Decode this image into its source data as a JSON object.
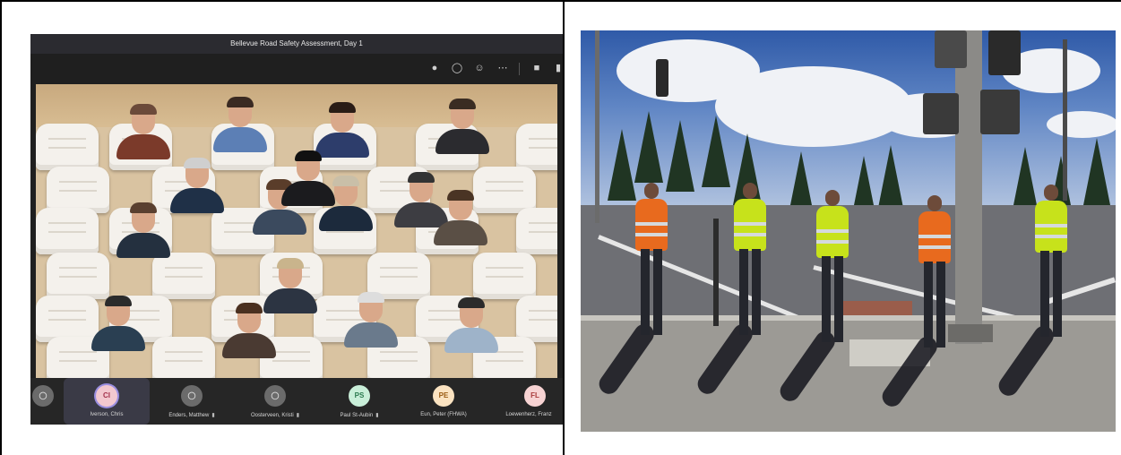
{
  "meeting": {
    "title": "Bellevue Road Safety Assessment, Day 1",
    "toolbar_icons": [
      "people-icon",
      "chat-icon",
      "reactions-icon",
      "more-icon",
      "camera-icon",
      "mic-icon"
    ],
    "participants": [
      {
        "name": "",
        "initials": "",
        "icon": "user-icon",
        "color": "#6b6b6b"
      },
      {
        "name": "Iverson, Chris",
        "initials": "CI",
        "color": "#f3c8cf",
        "active": true
      },
      {
        "name": "Enders, Matthew",
        "initials": "",
        "icon": "user-icon",
        "color": "#6b6b6b",
        "muted": true
      },
      {
        "name": "Oosterveen, Kristi",
        "initials": "",
        "icon": "user-icon",
        "color": "#6b6b6b",
        "muted": true
      },
      {
        "name": "Paul St-Aubin",
        "initials": "PS",
        "color": "#c9efd9",
        "muted": true
      },
      {
        "name": "Eun, Peter (FHWA)",
        "initials": "PE",
        "color": "#fbe3c1"
      },
      {
        "name": "Loewenherz, Franz",
        "initials": "FL",
        "color": "#f7d3d3"
      }
    ]
  },
  "colors": {
    "teams_bg": "#1f1f1f",
    "vest_orange": "#e86a1e",
    "vest_yellow": "#c7e21b"
  }
}
